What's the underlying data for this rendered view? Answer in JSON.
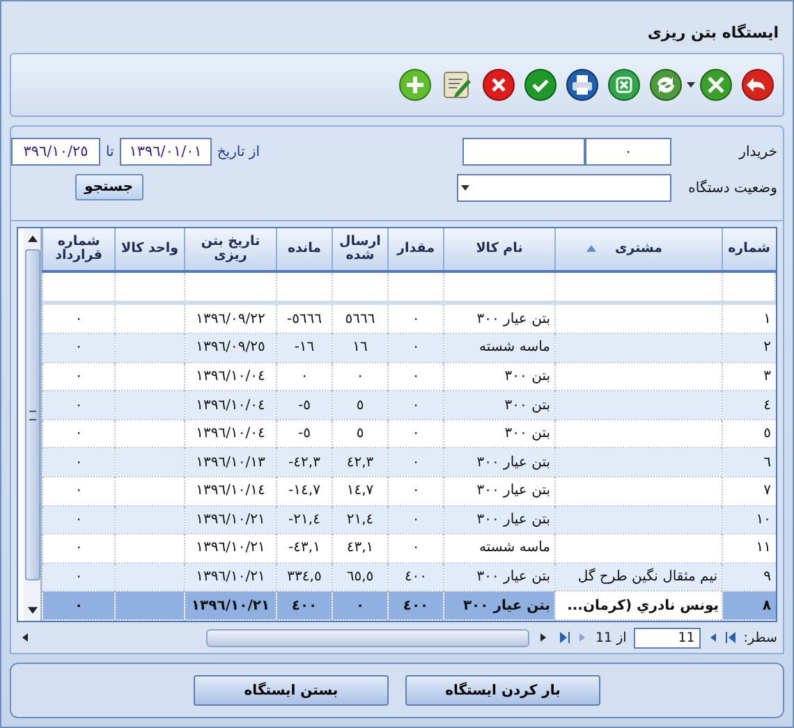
{
  "window": {
    "title": "ایستگاه بتن ریزی"
  },
  "filters": {
    "buyer_label": "خریدار",
    "buyer_code": "٠",
    "status_label": "وضعیت دستگاه",
    "from_label": "از تاریخ",
    "from_date": "١٣٩٦/٠١/٠١",
    "to_label": "تا",
    "to_date": "٣٩٦/١٠/٢٥",
    "search_button": "جستجو"
  },
  "table": {
    "columns": [
      {
        "label": "شماره",
        "sorted": false
      },
      {
        "label": "مشتری",
        "sorted": true
      },
      {
        "label": "نام کالا",
        "sorted": false
      },
      {
        "label": "مقدار",
        "sorted": false
      },
      {
        "label": "ارسال شده",
        "sorted": false
      },
      {
        "label": "مانده",
        "sorted": false
      },
      {
        "label": "تاریخ بتن ریزی",
        "sorted": false
      },
      {
        "label": "واحد کالا",
        "sorted": false
      },
      {
        "label": "شماره قرارداد",
        "sorted": false
      }
    ],
    "rows": [
      {
        "number": "١",
        "item": "بتن عیار ٣٠٠",
        "quantity": "٠",
        "sent": "٥٦٦٦",
        "remaining": "٥٦٦٦-",
        "date": "١٣٩٦/٠٩/٢٢",
        "contract": "٠",
        "selected": false
      },
      {
        "number": "٢",
        "item": "ماسه شسته",
        "quantity": "٠",
        "sent": "١٦",
        "remaining": "١٦-",
        "date": "١٣٩٦/٠٩/٢٥",
        "contract": "٠",
        "selected": false
      },
      {
        "number": "٣",
        "item": "بتن ٣٠٠",
        "quantity": "٠",
        "sent": "٠",
        "remaining": "٠",
        "date": "١٣٩٦/١٠/٠٤",
        "contract": "٠",
        "selected": false
      },
      {
        "number": "٤",
        "item": "بتن ٣٠٠",
        "quantity": "٠",
        "sent": "٥",
        "remaining": "٥-",
        "date": "١٣٩٦/١٠/٠٤",
        "contract": "٠",
        "selected": false
      },
      {
        "number": "٥",
        "item": "بتن ٣٠٠",
        "quantity": "٠",
        "sent": "٥",
        "remaining": "٥-",
        "date": "١٣٩٦/١٠/٠٤",
        "contract": "٠",
        "selected": false
      },
      {
        "number": "٦",
        "item": "بتن عیار ٣٠٠",
        "quantity": "٠",
        "sent": "٤٢,٣",
        "remaining": "٤٢,٣-",
        "date": "١٣٩٦/١٠/١٣",
        "contract": "٠",
        "selected": false
      },
      {
        "number": "٧",
        "item": "بتن عیار ٣٠٠",
        "quantity": "٠",
        "sent": "١٤,٧",
        "remaining": "١٤,٧-",
        "date": "١٣٩٦/١٠/١٤",
        "contract": "٠",
        "selected": false
      },
      {
        "number": "١٠",
        "item": "بتن عیار ٣٠٠",
        "quantity": "٠",
        "sent": "٢١,٤",
        "remaining": "٢١,٤-",
        "date": "١٣٩٦/١٠/٢١",
        "contract": "٠",
        "selected": false
      },
      {
        "number": "١١",
        "item": "ماسه شسته",
        "quantity": "٠",
        "sent": "٤٣,١",
        "remaining": "٤٣,١-",
        "date": "١٣٩٦/١٠/٢١",
        "contract": "٠",
        "selected": false
      },
      {
        "number": "٩",
        "customer": "نیم مثقال نگین طرح گل",
        "item": "بتن عیار ٣٠٠",
        "quantity": "٤٠٠",
        "sent": "٦٥,٥",
        "remaining": "٣٣٤,٥",
        "date": "١٣٩٦/١٠/٢١",
        "contract": "٠",
        "selected": false
      },
      {
        "number": "٨",
        "customer": "یونس نادري (کرمان...",
        "item": "بتن عیار ٣٠٠",
        "quantity": "٤٠٠",
        "sent": "٠",
        "remaining": "٤٠٠",
        "date": "١٣٩٦/١٠/٢١",
        "contract": "٠",
        "selected": true
      }
    ]
  },
  "pager": {
    "label": "سطر:",
    "current": "11",
    "of_label": "از 11"
  },
  "buttons": [
    "بار کردن ایستگاه",
    "بستن ایستگاه"
  ]
}
